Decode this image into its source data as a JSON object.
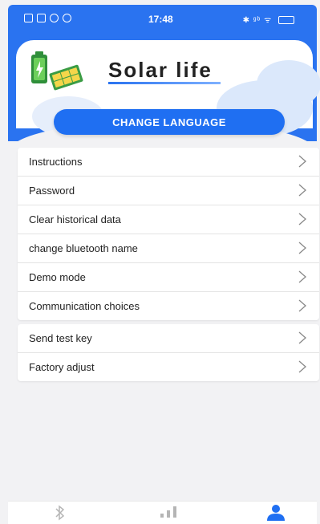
{
  "status_bar": {
    "time": "17:48",
    "right_indicators": "✱ ᵍᵇ ᯤ"
  },
  "header": {
    "app_title": "Solar life",
    "change_language_label": "CHANGE LANGUAGE"
  },
  "menu_group_1": [
    {
      "label": "Instructions",
      "icon": "chevron-right-icon"
    },
    {
      "label": "Password",
      "icon": "chevron-right-icon"
    },
    {
      "label": "Clear historical data",
      "icon": "chevron-right-icon"
    },
    {
      "label": "change bluetooth name",
      "icon": "chevron-right-icon"
    },
    {
      "label": "Demo mode",
      "icon": "chevron-right-icon"
    },
    {
      "label": "Communication choices",
      "icon": "chevron-right-icon"
    }
  ],
  "menu_group_2": [
    {
      "label": "Send test key",
      "icon": "chevron-right-icon"
    },
    {
      "label": "Factory adjust",
      "icon": "chevron-right-icon"
    }
  ],
  "bottom_nav": [
    {
      "icon": "bluetooth-icon",
      "active": false
    },
    {
      "icon": "signal-bars-icon",
      "active": false
    },
    {
      "icon": "person-icon",
      "active": true
    }
  ],
  "colors": {
    "accent": "#1f6ff2",
    "header_bg": "#2a73f0",
    "nav_inactive": "#b5b5b5"
  }
}
